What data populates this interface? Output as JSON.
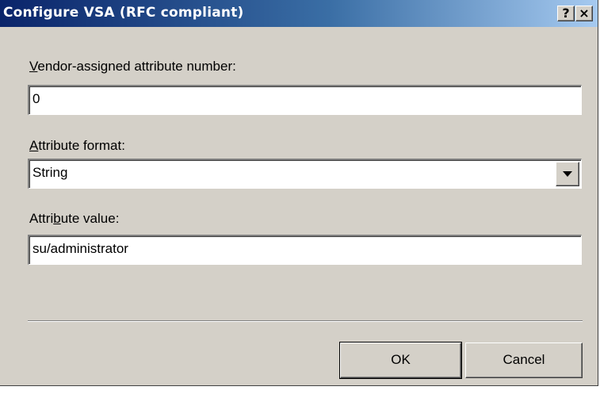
{
  "window": {
    "title": "Configure VSA (RFC compliant)",
    "help_label": "?",
    "close_label": "×"
  },
  "fields": {
    "vendor_number": {
      "label_mnemonic": "V",
      "label_rest": "endor-assigned attribute number:",
      "value": "0"
    },
    "attribute_format": {
      "label_mnemonic": "A",
      "label_rest": "ttribute format:",
      "value": "String",
      "icon": "chevron-down-icon"
    },
    "attribute_value": {
      "label_before": "Attri",
      "label_mnemonic": "b",
      "label_after": "ute value:",
      "value": "su/administrator"
    }
  },
  "buttons": {
    "ok_label": "OK",
    "cancel_label": "Cancel"
  },
  "colors": {
    "face": "#d4d0c8",
    "title_start": "#0a246a",
    "title_end": "#a6caf0"
  }
}
